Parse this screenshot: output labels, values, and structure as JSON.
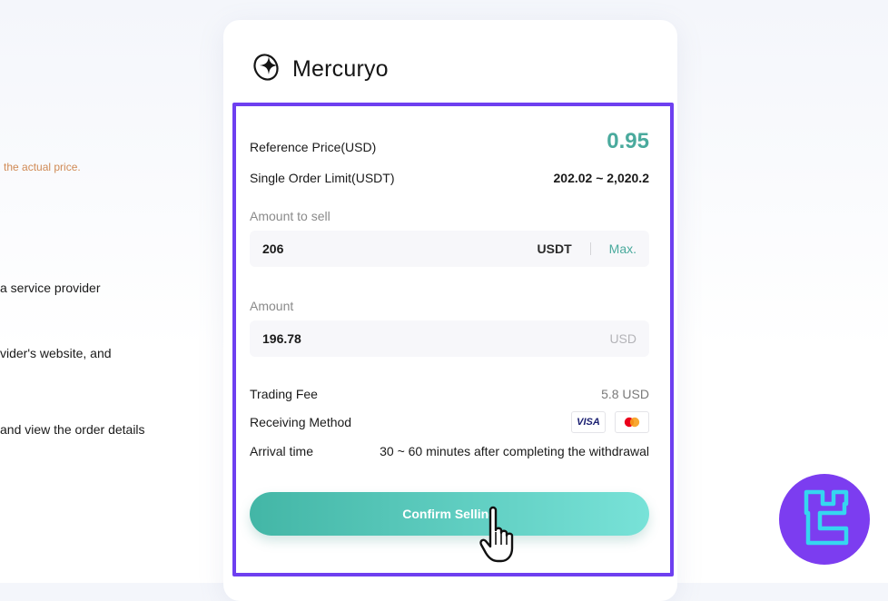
{
  "background": {
    "note": "the actual price.",
    "lines": [
      "a service provider",
      "vider's website, and",
      "and view the order details"
    ]
  },
  "brand": {
    "name": "Mercuryo",
    "icon": "mercuryo-logo-icon"
  },
  "quote": {
    "reference_price_label": "Reference Price(USD)",
    "reference_price_value": "0.95",
    "limit_label": "Single Order Limit(USDT)",
    "limit_value": "202.02 ~ 2,020.2"
  },
  "sell": {
    "label": "Amount to sell",
    "value": "206",
    "unit": "USDT",
    "max_label": "Max."
  },
  "receive": {
    "label": "Amount",
    "value": "196.78",
    "unit": "USD"
  },
  "details": {
    "fee_label": "Trading Fee",
    "fee_value": "5.8 USD",
    "method_label": "Receiving Method",
    "method_cards": [
      "VISA",
      "mastercard"
    ],
    "arrival_label": "Arrival time",
    "arrival_value": "30 ~ 60 minutes after completing the withdrawal"
  },
  "action": {
    "confirm_label": "Confirm Selling"
  },
  "colors": {
    "accent": "#4aaa9d",
    "highlight": "#6e3ff0",
    "button_start": "#43b6a6",
    "button_end": "#78e2d8",
    "watermark": "#7c3df0"
  }
}
